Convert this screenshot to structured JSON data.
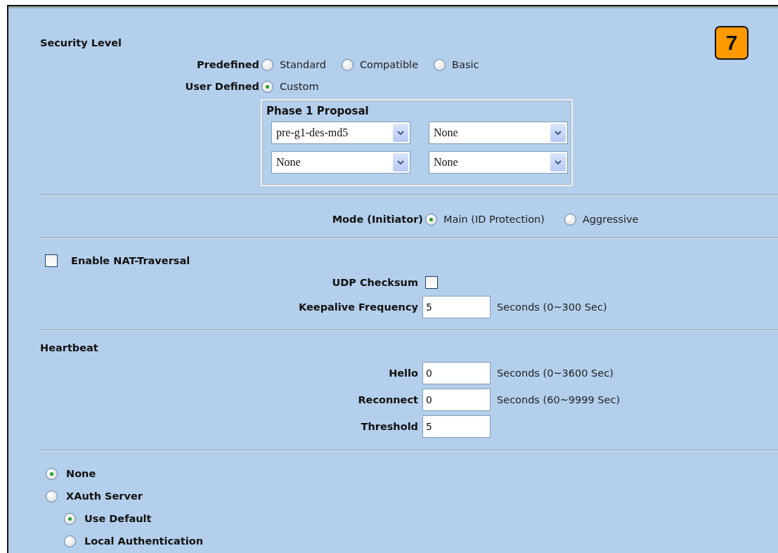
{
  "badge": "7",
  "security": {
    "title": "Security Level",
    "predefined": {
      "label": "Predefined",
      "options": [
        {
          "label": "Standard",
          "selected": false
        },
        {
          "label": "Compatible",
          "selected": false
        },
        {
          "label": "Basic",
          "selected": false
        }
      ]
    },
    "user_defined": {
      "label": "User Defined",
      "options": [
        {
          "label": "Custom",
          "selected": true
        }
      ]
    },
    "proposal": {
      "title": "Phase 1 Proposal",
      "selects": [
        "pre-g1-des-md5",
        "None",
        "None",
        "None"
      ]
    }
  },
  "mode": {
    "label": "Mode (Initiator)",
    "options": [
      {
        "label": "Main (ID Protection)",
        "selected": true
      },
      {
        "label": "Aggressive",
        "selected": false
      }
    ]
  },
  "nat": {
    "label": "Enable NAT-Traversal",
    "checked": false,
    "udp": {
      "label": "UDP Checksum",
      "checked": false
    },
    "keepalive": {
      "label": "Keepalive Frequency",
      "value": "5",
      "hint": "Seconds (0~300 Sec)"
    }
  },
  "heartbeat": {
    "title": "Heartbeat",
    "fields": [
      {
        "label": "Hello",
        "value": "0",
        "hint": "Seconds (0~3600 Sec)"
      },
      {
        "label": "Reconnect",
        "value": "0",
        "hint": "Seconds (60~9999 Sec)"
      },
      {
        "label": "Threshold",
        "value": "5"
      }
    ]
  },
  "auth": {
    "options": [
      {
        "label": "None",
        "selected": true
      },
      {
        "label": "XAuth Server",
        "selected": false,
        "children": [
          {
            "label": "Use Default",
            "selected": true
          },
          {
            "label": "Local Authentication",
            "selected": false
          }
        ]
      }
    ]
  }
}
